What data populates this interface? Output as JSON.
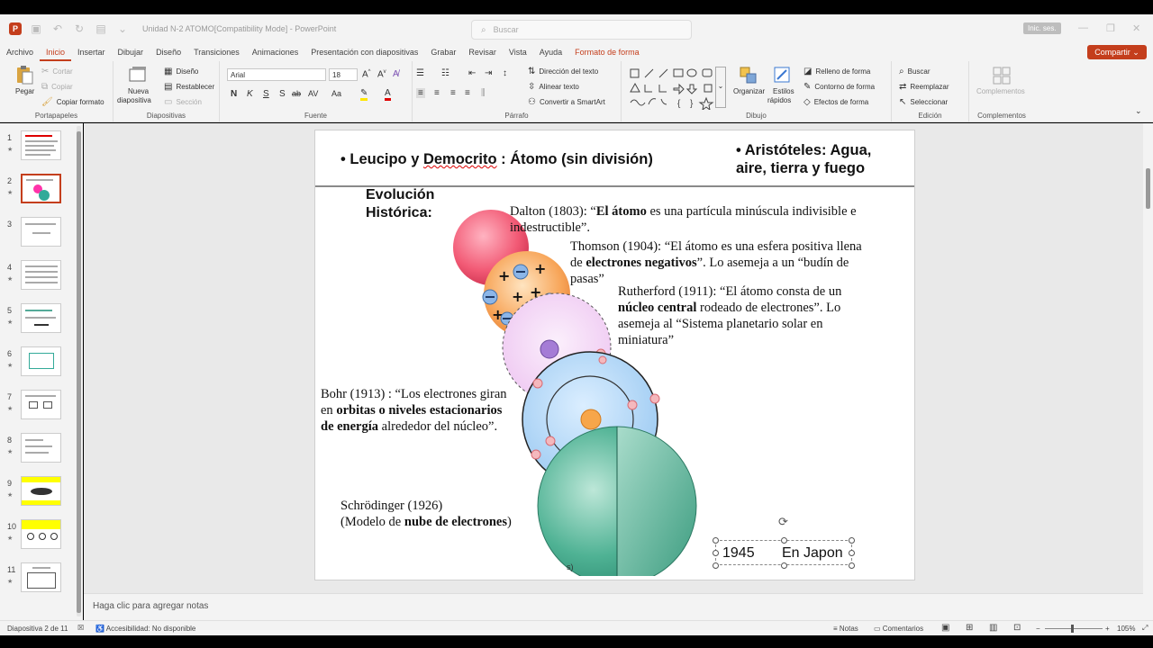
{
  "titlebar": {
    "doc_title": "Unidad N-2 ATOMO[Compatibility Mode] - PowerPoint",
    "search_placeholder": "Buscar",
    "signin_label": "Inic. ses."
  },
  "tabs": [
    "Archivo",
    "Inicio",
    "Insertar",
    "Dibujar",
    "Diseño",
    "Transiciones",
    "Animaciones",
    "Presentación con diapositivas",
    "Grabar",
    "Revisar",
    "Vista",
    "Ayuda",
    "Formato de forma"
  ],
  "share_label": "Compartir",
  "ribbon": {
    "portapapeles": {
      "label": "Portapapeles",
      "pegar": "Pegar",
      "cortar": "Cortar",
      "copiar": "Copiar",
      "copiar_formato": "Copiar formato"
    },
    "diapositivas": {
      "label": "Diapositivas",
      "nueva_1": "Nueva",
      "nueva_2": "diapositiva",
      "diseno": "Diseño",
      "restablecer": "Restablecer",
      "seccion": "Sección"
    },
    "fuente": {
      "label": "Fuente",
      "font_name": "Arial",
      "font_size": "18",
      "bold": "N",
      "italic": "K",
      "underline": "S",
      "strike": "S",
      "abc": "ab",
      "spacing": "AV",
      "case": "Aa"
    },
    "parrafo": {
      "label": "Párrafo",
      "direccion": "Dirección del texto",
      "alinear": "Alinear texto",
      "smartart": "Convertir a SmartArt"
    },
    "dibujo": {
      "label": "Dibujo",
      "organizar": "Organizar",
      "estilos_1": "Estilos",
      "estilos_2": "rápidos",
      "relleno": "Relleno de forma",
      "contorno": "Contorno de forma",
      "efectos": "Efectos de forma"
    },
    "edicion": {
      "label": "Edición",
      "buscar": "Buscar",
      "reemplazar": "Reemplazar",
      "seleccionar": "Seleccionar"
    },
    "complementos": {
      "label": "Complementos",
      "btn": "Complementos"
    }
  },
  "thumbnails": [
    "1",
    "2",
    "3",
    "4",
    "5",
    "6",
    "7",
    "8",
    "9",
    "10",
    "11"
  ],
  "slide": {
    "leucipo_prefix": "• Leucipo y ",
    "democrito": "Democrito",
    "leucipo_suffix": " :  Átomo (sin división)",
    "aristoteles_1": "• Aristóteles: Agua,",
    "aristoteles_2": "aire, tierra y fuego",
    "evolucion_1": "Evolución",
    "evolucion_2": "Histórica:",
    "dalton_a": "Dalton (1803): “",
    "dalton_b": "El átomo",
    "dalton_c": " es una partícula minúscula indivisible e",
    "dalton_d": "indestructible”.",
    "thomson_a": "Thomson (1904): “El átomo es una esfera positiva llena",
    "thomson_b": "de ",
    "thomson_c": "electrones negativos",
    "thomson_d": "”. Lo asemeja a un “budín de",
    "thomson_e": "pasas”",
    "rutherford_a": "Rutherford (1911): “El átomo consta de un",
    "rutherford_b": "núcleo central",
    "rutherford_c": " rodeado de electrones”. Lo",
    "rutherford_d": "asemeja al “Sistema planetario solar en",
    "rutherford_e": "miniatura”",
    "bohr_a": "Bohr (1913) : “Los electrones giran",
    "bohr_b": "en ",
    "bohr_c": "orbitas o niveles estacionarios",
    "bohr_d": "de energía",
    "bohr_e": " alrededor del núcleo”.",
    "schrod_a": "Schrödinger (1926)",
    "schrod_b": "(Modelo de ",
    "schrod_c": "nube de electrones",
    "schrod_d": ")",
    "small_s": "s)",
    "textbox_year": "1945",
    "textbox_text": "En Japon"
  },
  "notes_placeholder": "Haga clic para agregar notas",
  "status": {
    "slide_of": "Diapositiva 2 de 11",
    "accessibility": "Accesibilidad: No disponible",
    "notas": "Notas",
    "comentarios": "Comentarios",
    "zoom": "105%"
  },
  "colors": {
    "accent": "#c43e1c"
  }
}
